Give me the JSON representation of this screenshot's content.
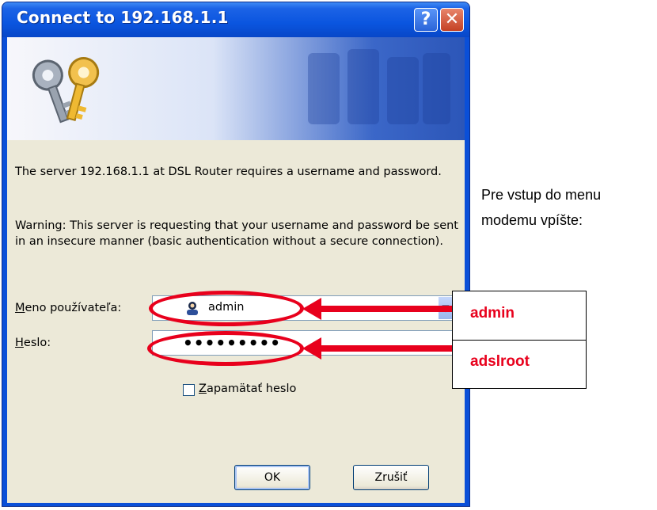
{
  "dialog": {
    "title": "Connect to 192.168.1.1",
    "help_button": "?",
    "close_button": "✕",
    "message": "The server 192.168.1.1 at DSL Router requires a username and password.",
    "warning": "Warning: This server is requesting that your username and password be sent in an insecure manner (basic authentication without a secure connection).",
    "username_label_prefix": "M",
    "username_label_rest": "eno používateľa:",
    "username_value": "admin",
    "password_label_prefix": "H",
    "password_label_rest": "eslo:",
    "password_value": "•••••••••",
    "remember_label_prefix": "Z",
    "remember_label_rest": "apamätať heslo",
    "remember_checked": false,
    "ok_label": "OK",
    "cancel_label": "Zrušiť"
  },
  "annotation": {
    "username_hint": "admin",
    "password_hint": "adslroot",
    "side_line1": "Pre vstup do menu",
    "side_line2": "modemu vpíšte:",
    "accent_color": "#e8001c"
  }
}
